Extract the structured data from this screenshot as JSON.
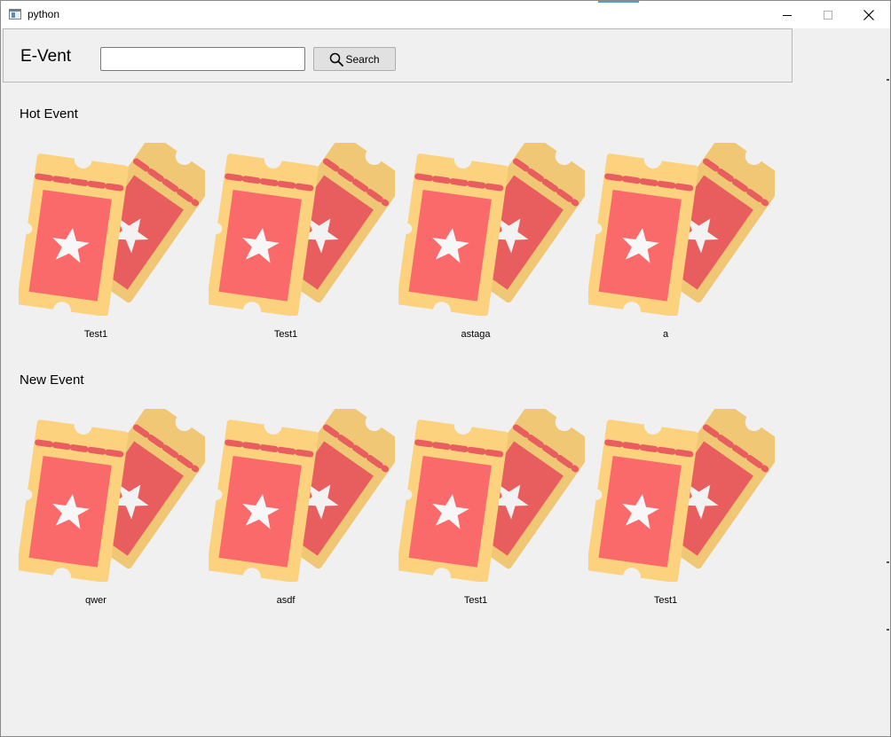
{
  "window": {
    "title": "python"
  },
  "header": {
    "logo": "E-Vent",
    "search": {
      "value": "",
      "placeholder": ""
    },
    "search_button_label": "Search"
  },
  "sections": {
    "hot": {
      "title": "Hot Event",
      "events": [
        {
          "name": "Test1"
        },
        {
          "name": "Test1"
        },
        {
          "name": "astaga"
        },
        {
          "name": "a"
        }
      ]
    },
    "new": {
      "title": "New Event",
      "events": [
        {
          "name": "qwer"
        },
        {
          "name": "asdf"
        },
        {
          "name": "Test1"
        },
        {
          "name": "Test1"
        }
      ]
    }
  },
  "icons": {
    "app": "python-window-icon",
    "search": "search-icon",
    "event_image": "ticket-icon"
  },
  "colors": {
    "background": "#f0f0f0",
    "ticket_yellow": "#fcd27f",
    "ticket_yellow_dark": "#f0c774",
    "ticket_red": "#fb6a6a",
    "ticket_red_dark": "#e85d5d"
  }
}
